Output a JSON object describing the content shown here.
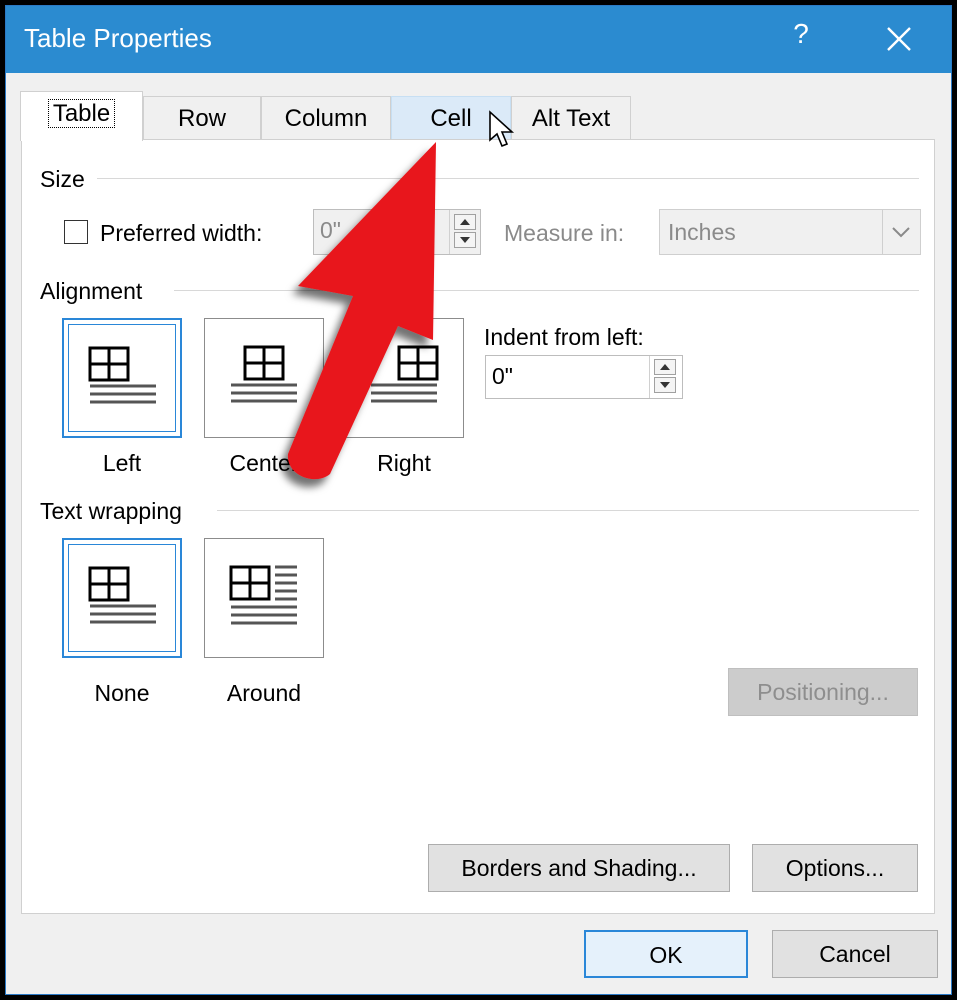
{
  "window": {
    "title": "Table Properties",
    "help_label": "?",
    "close_icon": "close-icon"
  },
  "tabs": [
    {
      "label": "Table",
      "state": "active"
    },
    {
      "label": "Row",
      "state": "normal"
    },
    {
      "label": "Column",
      "state": "normal"
    },
    {
      "label": "Cell",
      "state": "hover"
    },
    {
      "label": "Alt Text",
      "state": "normal"
    }
  ],
  "size": {
    "section_label": "Size",
    "preferred_width_label": "Preferred width:",
    "preferred_width_checked": false,
    "width_value": "0\"",
    "measure_in_label": "Measure in:",
    "measure_in_value": "Inches"
  },
  "alignment": {
    "section_label": "Alignment",
    "options": [
      {
        "label": "Left",
        "selected": true
      },
      {
        "label": "Center",
        "selected": false
      },
      {
        "label": "Right",
        "selected": false
      }
    ],
    "indent_label": "Indent from left:",
    "indent_value": "0\""
  },
  "text_wrapping": {
    "section_label": "Text wrapping",
    "options": [
      {
        "label": "None",
        "selected": true
      },
      {
        "label": "Around",
        "selected": false
      }
    ],
    "positioning_label": "Positioning..."
  },
  "buttons": {
    "borders_shading": "Borders and Shading...",
    "options": "Options...",
    "ok": "OK",
    "cancel": "Cancel"
  },
  "annotation": {
    "arrow_color": "#e8141b",
    "cursor": "mouse-pointer-icon"
  }
}
